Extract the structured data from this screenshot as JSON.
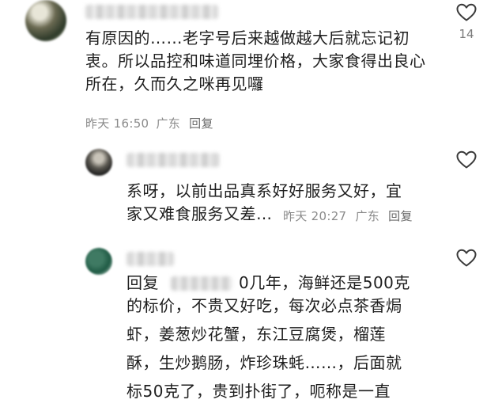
{
  "comments": [
    {
      "text": "有原因的……老字号后来越做越大后就忘记初衷。所以品控和味道同埋价格，大家食得出良心所在，久而久之咪再见囉",
      "time": "昨天 16:50",
      "location": "广东",
      "reply_label": "回复",
      "likes": "14",
      "like_icon": "heart-outline-icon"
    },
    {
      "line1": "系呀，以前出品真系好好服务又好，宜",
      "line2": "家又难食服务又差…",
      "time": "昨天 20:27",
      "location": "广东",
      "reply_label": "回复",
      "like_icon": "heart-outline-icon"
    },
    {
      "reply_prefix": "回复",
      "lines": [
        "0几年，海鲜还是500克",
        "的标价，不贵又好吃，每次必点茶香焗",
        "虾，姜葱炒花蟹，东江豆腐煲，榴莲",
        "酥，生炒鹅肠，炸珍珠蚝……，后面就",
        "标50克了，贵到扑街了，呃称是一直"
      ],
      "like_icon": "heart-outline-icon"
    }
  ]
}
